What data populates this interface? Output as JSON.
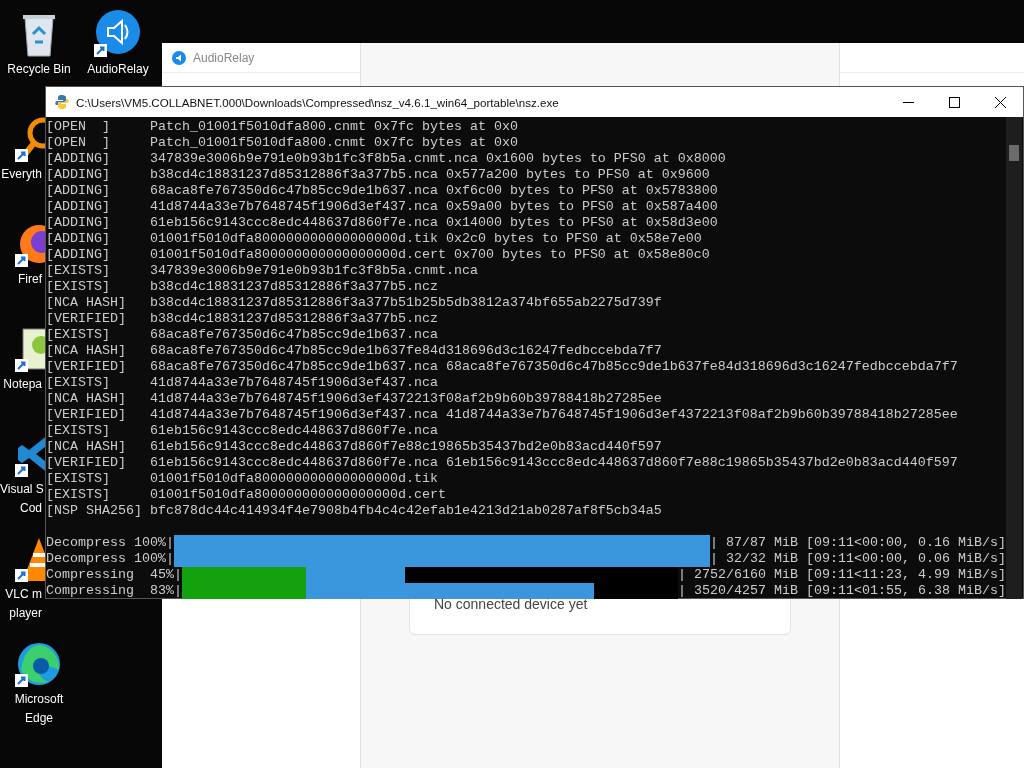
{
  "desktop_icons": [
    {
      "kind": "recycle",
      "label_lines": [
        "Recycle Bin"
      ],
      "clipped": false,
      "shortcut": false
    },
    {
      "kind": "everything",
      "label_lines": [
        "Everyth"
      ],
      "clipped": true,
      "shortcut": true
    },
    {
      "kind": "firefox",
      "label_lines": [
        "Firef"
      ],
      "clipped": true,
      "shortcut": true
    },
    {
      "kind": "notepad",
      "label_lines": [
        "Notepa"
      ],
      "clipped": true,
      "shortcut": true
    },
    {
      "kind": "vscode",
      "label_lines": [
        "Visual S",
        "Cod"
      ],
      "clipped": true,
      "shortcut": true
    },
    {
      "kind": "vlc",
      "label_lines": [
        "VLC m",
        "player"
      ],
      "clipped": true,
      "shortcut": true
    },
    {
      "kind": "edge",
      "label_lines": [
        "Microsoft",
        "Edge"
      ],
      "clipped": false,
      "shortcut": true
    },
    {
      "kind": "audiorelay",
      "label_lines": [
        "AudioRelay"
      ],
      "clipped": false,
      "shortcut": true
    }
  ],
  "audiorelay_window": {
    "title": "AudioRelay",
    "status": "No connected device yet"
  },
  "console": {
    "title": "C:\\Users\\VM5.COLLABNET.000\\Downloads\\Compressed\\nsz_v4.6.1_win64_portable\\nsz.exe",
    "lines": [
      "[OPEN  ]     Patch_01001f5010dfa800.cnmt 0x7fc bytes at 0x0",
      "[OPEN  ]     Patch_01001f5010dfa800.cnmt 0x7fc bytes at 0x0",
      "[ADDING]     347839e3006b9e791e0b93b1fc3f8b5a.cnmt.nca 0x1600 bytes to PFS0 at 0x8000",
      "[ADDING]     b38cd4c18831237d85312886f3a377b5.nca 0x577a200 bytes to PFS0 at 0x9600",
      "[ADDING]     68aca8fe767350d6c47b85cc9de1b637.nca 0xf6c00 bytes to PFS0 at 0x5783800",
      "[ADDING]     41d8744a33e7b7648745f1906d3ef437.nca 0x59a00 bytes to PFS0 at 0x587a400",
      "[ADDING]     61eb156c9143ccc8edc448637d860f7e.nca 0x14000 bytes to PFS0 at 0x58d3e00",
      "[ADDING]     01001f5010dfa800000000000000000d.tik 0x2c0 bytes to PFS0 at 0x58e7e00",
      "[ADDING]     01001f5010dfa800000000000000000d.cert 0x700 bytes to PFS0 at 0x58e80c0",
      "[EXISTS]     347839e3006b9e791e0b93b1fc3f8b5a.cnmt.nca",
      "[EXISTS]     b38cd4c18831237d85312886f3a377b5.ncz",
      "[NCA HASH]   b38cd4c18831237d85312886f3a377b51b25b5db3812a374bf655ab2275d739f",
      "[VERIFIED]   b38cd4c18831237d85312886f3a377b5.ncz",
      "[EXISTS]     68aca8fe767350d6c47b85cc9de1b637.nca",
      "[NCA HASH]   68aca8fe767350d6c47b85cc9de1b637fe84d318696d3c16247fedbccebda7f7",
      "[VERIFIED]   68aca8fe767350d6c47b85cc9de1b637.nca 68aca8fe767350d6c47b85cc9de1b637fe84d318696d3c16247fedbccebda7f7",
      "[EXISTS]     41d8744a33e7b7648745f1906d3ef437.nca",
      "[NCA HASH]   41d8744a33e7b7648745f1906d3ef4372213f08af2b9b60b39788418b27285ee",
      "[VERIFIED]   41d8744a33e7b7648745f1906d3ef437.nca 41d8744a33e7b7648745f1906d3ef4372213f08af2b9b60b39788418b27285ee",
      "[EXISTS]     61eb156c9143ccc8edc448637d860f7e.nca",
      "[NCA HASH]   61eb156c9143ccc8edc448637d860f7e88c19865b35437bd2e0b83acd440f597",
      "[VERIFIED]   61eb156c9143ccc8edc448637d860f7e.nca 61eb156c9143ccc8edc448637d860f7e88c19865b35437bd2e0b83acd440f597",
      "[EXISTS]     01001f5010dfa800000000000000000d.tik",
      "[EXISTS]     01001f5010dfa800000000000000000d.cert",
      "[NSP SHA256] bfc878dc44c414934f4e7908b4fb4c4c42efab1e4213d21ab0287af8f5cb34a5"
    ],
    "progress": [
      {
        "kind": "decompress",
        "label": "Decompress 100%|",
        "level": 1,
        "info": "| 87/87 MiB [09:11<00:00, 0.16 MiB/s]"
      },
      {
        "kind": "decompress",
        "label": "Decompress 100%|",
        "level": 1,
        "info": "| 32/32 MiB [09:11<00:00, 0.06 MiB/s]"
      },
      {
        "kind": "compressing",
        "label": "Compressing  45%|",
        "level": 0.45,
        "info": "| 2752/6160 MiB [09:11<11:23, 4.99 MiB/s]"
      },
      {
        "kind": "compressing",
        "label": "Compressing  83%|",
        "level": 0.83,
        "info": "| 3520/4257 MiB [09:11<01:55, 6.38 MiB/s]"
      }
    ]
  }
}
